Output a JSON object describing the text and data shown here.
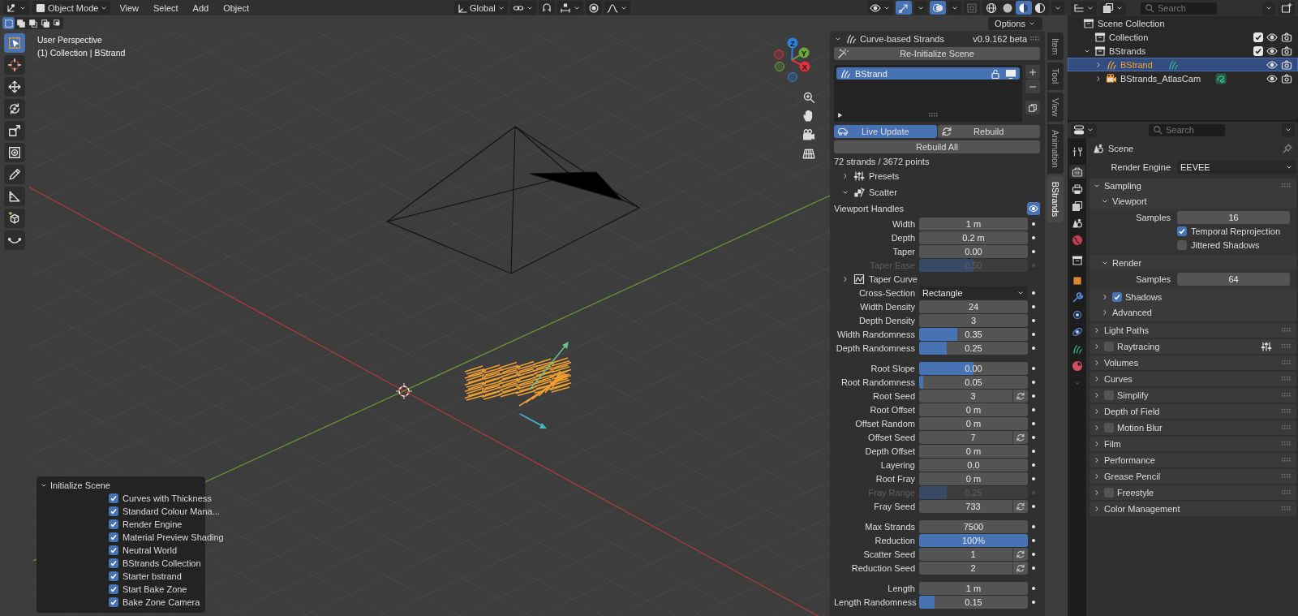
{
  "header": {
    "mode": "Object Mode",
    "menus": [
      "View",
      "Select",
      "Add",
      "Object"
    ],
    "orientation": "Global"
  },
  "select_modes": [
    {
      "kind": "set",
      "selected": true
    },
    {
      "kind": "extend",
      "selected": false
    },
    {
      "kind": "subtract",
      "selected": false
    },
    {
      "kind": "difference",
      "selected": false
    },
    {
      "kind": "intersect",
      "selected": false
    }
  ],
  "shading_modes": [
    {
      "kind": "wireframe",
      "selected": false
    },
    {
      "kind": "solid",
      "selected": false
    },
    {
      "kind": "material",
      "selected": true
    },
    {
      "kind": "rendered",
      "selected": false
    }
  ],
  "options_button": "Options",
  "tools": [
    {
      "kind": "select_box",
      "selected": true
    },
    {
      "kind": "cursor",
      "selected": false
    },
    {
      "kind": "move",
      "selected": false
    },
    {
      "kind": "rotate",
      "selected": false
    },
    {
      "kind": "scale",
      "selected": false
    },
    {
      "kind": "transform",
      "selected": false
    },
    {
      "kind": "annotate",
      "selected": false
    },
    {
      "kind": "measure",
      "selected": false
    },
    {
      "kind": "add_cube",
      "selected": false
    },
    {
      "kind": "curve",
      "selected": false
    }
  ],
  "overlay": {
    "view_name": "User Perspective",
    "object_info": "(1) Collection | BStrand"
  },
  "gizmo": [
    {
      "label": "Z",
      "color": "#2f7fe0"
    },
    {
      "label": "Y",
      "color": "#6ea534"
    },
    {
      "label": "X",
      "color": "#e0323e"
    }
  ],
  "initialize_panel": {
    "title": "Initialize Scene",
    "options": [
      {
        "label": "Curves with Thickness",
        "checked": true
      },
      {
        "label": "Standard Colour Mana...",
        "checked": true
      },
      {
        "label": "Render Engine",
        "checked": true
      },
      {
        "label": "Material Preview Shading",
        "checked": true
      },
      {
        "label": "Neutral World",
        "checked": true
      },
      {
        "label": "BStrands Collection",
        "checked": true
      },
      {
        "label": "Starter bstrand",
        "checked": true
      },
      {
        "label": "Start Bake Zone",
        "checked": true
      },
      {
        "label": "Bake Zone Camera",
        "checked": true
      }
    ]
  },
  "strands_panel": {
    "title": "Curve-based Strands",
    "version": "v0.9.162 beta",
    "reinit_button": "Re-Initialize Scene",
    "list": [
      {
        "name": "BStrand",
        "selected": true
      }
    ],
    "live_update": {
      "label": "Live Update",
      "on": true
    },
    "rebuild_button": "Rebuild",
    "rebuild_all_button": "Rebuild All",
    "stats": "72 strands / 3672 points",
    "subpanels": [
      {
        "label": "Presets",
        "expanded": false
      },
      {
        "label": "Scatter",
        "expanded": true
      }
    ],
    "handles": {
      "label": "Viewport Handles",
      "on": true
    },
    "groups": [
      {
        "rows": [
          {
            "kind": "number",
            "label": "Width",
            "value": "1 m",
            "disabled": false
          },
          {
            "kind": "number",
            "label": "Depth",
            "value": "0.2 m",
            "disabled": false
          },
          {
            "kind": "number",
            "label": "Taper",
            "value": "0.00",
            "disabled": false
          },
          {
            "kind": "slider",
            "label": "Taper Ease",
            "value": "0.50",
            "level": 0.5,
            "disabled": true
          },
          {
            "kind": "expander",
            "label": "Taper Curve",
            "expanded": false
          },
          {
            "kind": "dropdown",
            "label": "Cross-Section",
            "value": "Rectangle",
            "disabled": false
          },
          {
            "kind": "number",
            "label": "Width Density",
            "value": "24",
            "disabled": false
          },
          {
            "kind": "number",
            "label": "Depth Density",
            "value": "3",
            "disabled": false
          },
          {
            "kind": "slider",
            "label": "Width Randomness",
            "value": "0.35",
            "level": 0.35,
            "disabled": false
          },
          {
            "kind": "slider",
            "label": "Depth Randomness",
            "value": "0.25",
            "level": 0.25,
            "disabled": false
          }
        ]
      },
      {
        "rows": [
          {
            "kind": "slider",
            "label": "Root Slope",
            "value": "0.00",
            "level": 0.5,
            "disabled": false
          },
          {
            "kind": "slider",
            "label": "Root Randomness",
            "value": "0.05",
            "level": 0.04,
            "disabled": false
          },
          {
            "kind": "seed",
            "label": "Root Seed",
            "value": "3",
            "disabled": false
          },
          {
            "kind": "number",
            "label": "Root Offset",
            "value": "0 m",
            "disabled": false
          },
          {
            "kind": "number",
            "label": "Offset Random",
            "value": "0 m",
            "disabled": false
          },
          {
            "kind": "seed",
            "label": "Offset Seed",
            "value": "7",
            "disabled": false
          },
          {
            "kind": "number",
            "label": "Depth Offset",
            "value": "0 m",
            "disabled": false
          },
          {
            "kind": "number",
            "label": "Layering",
            "value": "0.0",
            "disabled": false
          },
          {
            "kind": "number",
            "label": "Root Fray",
            "value": "0 m",
            "disabled": false
          },
          {
            "kind": "slider",
            "label": "Fray Range",
            "value": "0.25",
            "level": 0.25,
            "disabled": true
          },
          {
            "kind": "seed",
            "label": "Fray Seed",
            "value": "733",
            "disabled": false
          }
        ]
      },
      {
        "rows": [
          {
            "kind": "number",
            "label": "Max Strands",
            "value": "7500",
            "disabled": false
          },
          {
            "kind": "slider",
            "label": "Reduction",
            "value": "100%",
            "level": 1,
            "disabled": false
          },
          {
            "kind": "seed",
            "label": "Scatter Seed",
            "value": "1",
            "disabled": false
          },
          {
            "kind": "seed",
            "label": "Reduction Seed",
            "value": "2",
            "disabled": false
          }
        ]
      },
      {
        "rows": [
          {
            "kind": "number",
            "label": "Length",
            "value": "1 m",
            "disabled": false
          },
          {
            "kind": "slider",
            "label": "Length Randomness",
            "value": "0.15",
            "level": 0.14,
            "disabled": false
          }
        ]
      }
    ]
  },
  "sidebar_tabs": [
    {
      "label": "Item",
      "selected": false
    },
    {
      "label": "Tool",
      "selected": false
    },
    {
      "label": "View",
      "selected": false
    },
    {
      "label": "Animation",
      "selected": false
    },
    {
      "label": "BStrands",
      "selected": true
    }
  ],
  "outliner": {
    "search_placeholder": "Search",
    "tree": [
      {
        "label": "Scene Collection",
        "kind": "scene",
        "selected": false,
        "children": [
          {
            "label": "Collection",
            "kind": "collection",
            "selected": false,
            "checked": true
          },
          {
            "label": "BStrands",
            "kind": "collection",
            "selected": false,
            "checked": true,
            "expanded": true,
            "children": [
              {
                "label": "BStrand",
                "kind": "strands",
                "selected": true,
                "expanded": false
              },
              {
                "label": "BStrands_AtlasCam",
                "kind": "camera",
                "selected": false,
                "expanded": false
              }
            ]
          }
        ]
      }
    ]
  },
  "properties": {
    "search_placeholder": "Search",
    "tabs": [
      {
        "kind": "tool",
        "selected": false
      },
      {
        "kind": "render",
        "selected": true
      },
      {
        "kind": "output",
        "selected": false
      },
      {
        "kind": "view_layer",
        "selected": false
      },
      {
        "kind": "scene",
        "selected": false
      },
      {
        "kind": "world",
        "selected": false
      },
      {
        "kind": "collection",
        "selected": false
      },
      {
        "kind": "object",
        "selected": false
      },
      {
        "kind": "modifiers",
        "selected": false
      },
      {
        "kind": "particles",
        "selected": false
      },
      {
        "kind": "physics",
        "selected": false
      },
      {
        "kind": "strands",
        "selected": false
      },
      {
        "kind": "material",
        "selected": false
      }
    ],
    "context": "Scene",
    "render_engine": {
      "label": "Render Engine",
      "value": "EEVEE"
    },
    "panels": [
      {
        "label": "Sampling",
        "expanded": true,
        "presets_menu": false,
        "subpanels": [
          {
            "label": "Viewport",
            "expanded": true,
            "rows": [
              {
                "kind": "number",
                "label": "Samples",
                "value": "16"
              },
              {
                "kind": "checkbox",
                "label": "Temporal Reprojection",
                "checked": true
              },
              {
                "kind": "checkbox",
                "label": "Jittered Shadows",
                "checked": false
              }
            ]
          },
          {
            "label": "Render",
            "expanded": true,
            "rows": [
              {
                "kind": "number",
                "label": "Samples",
                "value": "64"
              }
            ]
          },
          {
            "label": "Shadows",
            "expanded": false,
            "checked": true
          },
          {
            "label": "Advanced",
            "expanded": false
          }
        ]
      },
      {
        "label": "Light Paths",
        "expanded": false,
        "presets_menu": false
      },
      {
        "label": "Raytracing",
        "expanded": false,
        "checked": false,
        "presets_menu": true
      },
      {
        "label": "Volumes",
        "expanded": false,
        "presets_menu": false
      },
      {
        "label": "Curves",
        "expanded": false,
        "presets_menu": false
      },
      {
        "label": "Simplify",
        "expanded": false,
        "checked": false,
        "presets_menu": false
      },
      {
        "label": "Depth of Field",
        "expanded": false,
        "presets_menu": false
      },
      {
        "label": "Motion Blur",
        "expanded": false,
        "checked": false,
        "presets_menu": false
      },
      {
        "label": "Film",
        "expanded": false,
        "presets_menu": false
      },
      {
        "label": "Performance",
        "expanded": false,
        "presets_menu": false
      },
      {
        "label": "Grease Pencil",
        "expanded": false,
        "presets_menu": false
      },
      {
        "label": "Freestyle",
        "expanded": false,
        "checked": false,
        "presets_menu": false
      },
      {
        "label": "Color Management",
        "expanded": false,
        "presets_menu": false
      }
    ]
  }
}
